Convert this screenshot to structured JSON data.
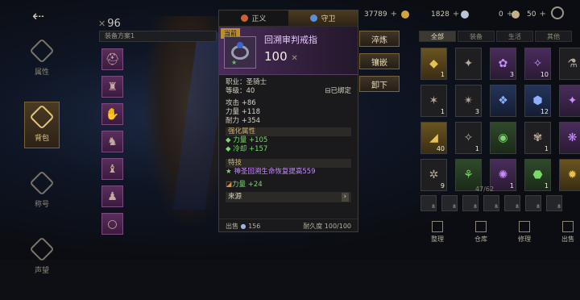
{
  "nav": {
    "back_glyph": "⇠",
    "items": [
      {
        "label": "属性",
        "icon": "attributes-icon",
        "active": false
      },
      {
        "label": "背包",
        "icon": "backpack-icon",
        "active": true
      },
      {
        "label": "称号",
        "icon": "title-icon",
        "active": false
      },
      {
        "label": "声望",
        "icon": "reputation-icon",
        "active": false
      }
    ]
  },
  "bag": {
    "count_prefix": "✕",
    "count": "96",
    "filter": "装备方案1"
  },
  "tooltip": {
    "tabs": [
      {
        "label": "正义",
        "active": false
      },
      {
        "label": "守卫",
        "active": true
      }
    ],
    "current_badge": "当前",
    "item_name": "回溯审判戒指",
    "score": "100",
    "score_suffix": "✕",
    "class_label": "职业：圣骑士",
    "level_label": "等级：40",
    "bound_label": "已绑定",
    "stats": [
      "攻击 +86",
      "力量 +118",
      "耐力 +354"
    ],
    "enhance_title": "强化属性",
    "enhance": [
      "力量 +105",
      "冷却 +157"
    ],
    "skill_title": "特技",
    "skill": "神圣回溯生命恢复提高559",
    "extra": "力量 +24",
    "source_label": "来源",
    "source_arrow": "›",
    "sell_label": "出售",
    "sell_value": "156",
    "durability_label": "耐久度",
    "durability_value": "100/100"
  },
  "actions": [
    "淬炼",
    "镶嵌",
    "卸下"
  ],
  "currency": [
    {
      "value": "37789",
      "color": "#8a7aff"
    },
    {
      "value": "1828",
      "color": "#d4a33a"
    },
    {
      "value": "0",
      "color": "#b8c4d8"
    },
    {
      "value": "50",
      "color": "#c4b08a"
    }
  ],
  "currency_plus": "+",
  "inventory": {
    "tabs": [
      {
        "label": "全部",
        "active": true
      },
      {
        "label": "装备",
        "active": false
      },
      {
        "label": "生活",
        "active": false
      },
      {
        "label": "其他",
        "active": false
      }
    ],
    "items": [
      {
        "glyph": "◆",
        "count": "1",
        "rarity": "gold"
      },
      {
        "glyph": "✦",
        "count": "",
        "rarity": "dark"
      },
      {
        "glyph": "✿",
        "count": "3",
        "rarity": "purple"
      },
      {
        "glyph": "✧",
        "count": "10",
        "rarity": "purple"
      },
      {
        "glyph": "⚗",
        "count": "",
        "rarity": "dark"
      },
      {
        "glyph": "✶",
        "count": "1",
        "rarity": "dark"
      },
      {
        "glyph": "✴",
        "count": "3",
        "rarity": "dark"
      },
      {
        "glyph": "❖",
        "count": "",
        "rarity": "blue"
      },
      {
        "glyph": "⬢",
        "count": "12",
        "rarity": "blue"
      },
      {
        "glyph": "✦",
        "count": "",
        "rarity": "purple"
      },
      {
        "glyph": "◢",
        "count": "40",
        "rarity": "gold"
      },
      {
        "glyph": "✧",
        "count": "1",
        "rarity": "dark"
      },
      {
        "glyph": "◉",
        "count": "",
        "rarity": "green"
      },
      {
        "glyph": "✾",
        "count": "1",
        "rarity": "dark"
      },
      {
        "glyph": "❋",
        "count": "",
        "rarity": "purple"
      },
      {
        "glyph": "✲",
        "count": "9",
        "rarity": "dark"
      },
      {
        "glyph": "⚘",
        "count": "",
        "rarity": "green"
      },
      {
        "glyph": "✺",
        "count": "1",
        "rarity": "purple"
      },
      {
        "glyph": "⬣",
        "count": "1",
        "rarity": "green"
      },
      {
        "glyph": "✹",
        "count": "",
        "rarity": "gold"
      }
    ],
    "capacity": "47/62",
    "quick_slots": [
      "8",
      "8",
      "8",
      "8",
      "8",
      "8",
      "8"
    ],
    "bottom_buttons": [
      "整理",
      "仓库",
      "修理",
      "出售"
    ]
  }
}
